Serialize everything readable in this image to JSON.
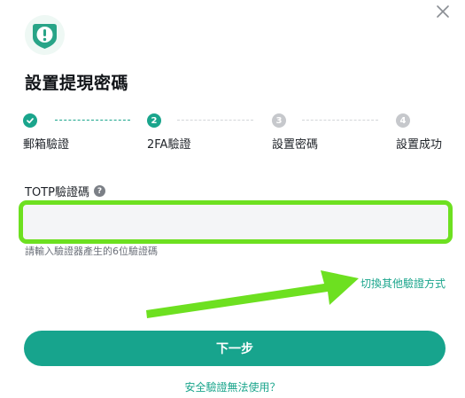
{
  "dialog": {
    "title": "設置提現密碼"
  },
  "steps": [
    {
      "label": "郵箱驗證",
      "status": "done",
      "marker": ""
    },
    {
      "label": "2FA驗證",
      "status": "active",
      "marker": "2"
    },
    {
      "label": "設置密碼",
      "status": "pending",
      "marker": "3"
    },
    {
      "label": "設置成功",
      "status": "pending",
      "marker": "4"
    }
  ],
  "totp": {
    "label": "TOTP驗證碼",
    "value": "",
    "placeholder": "",
    "hint": "請輸入驗證器產生的6位驗證碼"
  },
  "links": {
    "switch_method": "切換其他驗證方式",
    "unavailable": "安全驗證無法使用？"
  },
  "buttons": {
    "next": "下一步"
  },
  "icons": {
    "close": "close-icon",
    "app": "shield-alert-icon",
    "help": "help-circle-icon",
    "check": "check-icon"
  },
  "colors": {
    "accent": "#17a48d",
    "highlight": "#6de020",
    "pending": "#c6c8cc"
  }
}
